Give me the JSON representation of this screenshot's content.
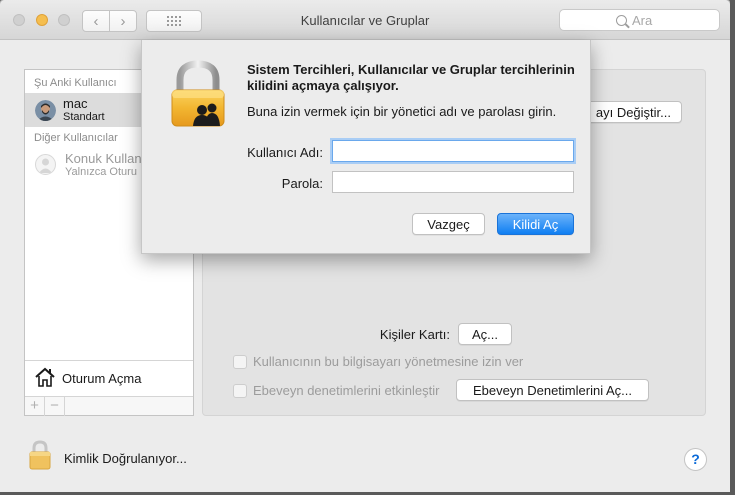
{
  "window": {
    "title": "Kullanıcılar ve Gruplar",
    "search_placeholder": "Ara",
    "back_glyph": "‹",
    "forward_glyph": "›"
  },
  "sidebar": {
    "current_header": "Şu Anki Kullanıcı",
    "current_user": {
      "name": "mac",
      "role": "Standart"
    },
    "other_header": "Diğer Kullanıcılar",
    "other_user": {
      "name": "Konuk Kullan",
      "role": "Yalnızca Oturu"
    },
    "login_label": "Oturum Açma",
    "add_glyph": "+",
    "remove_glyph": "−"
  },
  "right_panel": {
    "change_password_button": "ayı Değiştir...",
    "contacts_label": "Kişiler Kartı:",
    "open_button": "Aç...",
    "allow_admin_label": "Kullanıcının bu bilgisayarı yönetmesine izin ver",
    "enable_parental_label": "Ebeveyn denetimlerini etkinleştir",
    "open_parental_button": "Ebeveyn Denetimlerini Aç..."
  },
  "footer": {
    "status": "Kimlik Doğrulanıyor...",
    "help": "?"
  },
  "auth_sheet": {
    "title": "Sistem Tercihleri, Kullanıcılar ve Gruplar tercihlerinin kilidini açmaya çalışıyor.",
    "message": "Buna izin vermek için bir yönetici adı ve parolası girin.",
    "username_label": "Kullanıcı Adı:",
    "username_value": "",
    "password_label": "Parola:",
    "password_value": "",
    "cancel_button": "Vazgeç",
    "unlock_button": "Kilidi Aç"
  },
  "colors": {
    "accent": "#0f7ef2",
    "lock_gold": "#f2b631",
    "minimize_yellow": "#f5be4f"
  },
  "icons": [
    "lock-icon",
    "users-silhouette-icon",
    "home-icon",
    "search-icon",
    "help-icon",
    "grid-icon",
    "avatar-icon"
  ]
}
